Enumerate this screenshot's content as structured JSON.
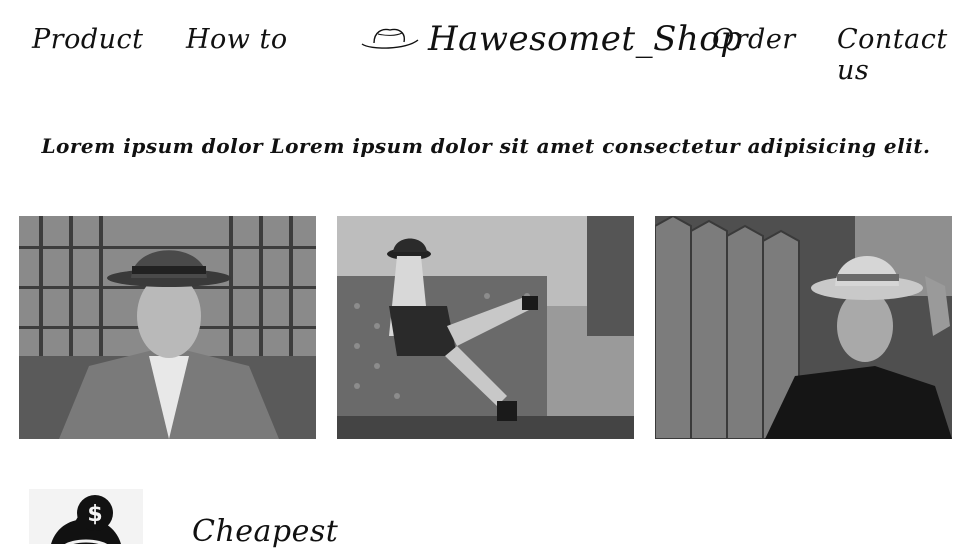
{
  "nav": {
    "items": [
      {
        "label": "Product"
      },
      {
        "label": "How to"
      },
      {
        "label": "Order"
      },
      {
        "label": "Contact us"
      }
    ]
  },
  "brand": {
    "title": "Hawesomet_Shop",
    "logo_icon": "hat-icon"
  },
  "hero": {
    "tagline": "Lorem ipsum dolor Lorem ipsum dolor sit amet consectetur adipisicing elit."
  },
  "gallery": {
    "photos": [
      {
        "subject": "man-in-fedora-suit"
      },
      {
        "subject": "woman-on-sofa-hat"
      },
      {
        "subject": "man-in-cowboy-hat"
      }
    ]
  },
  "features": [
    {
      "icon": "money-bag-dollar-icon",
      "title": "Cheapest"
    }
  ]
}
